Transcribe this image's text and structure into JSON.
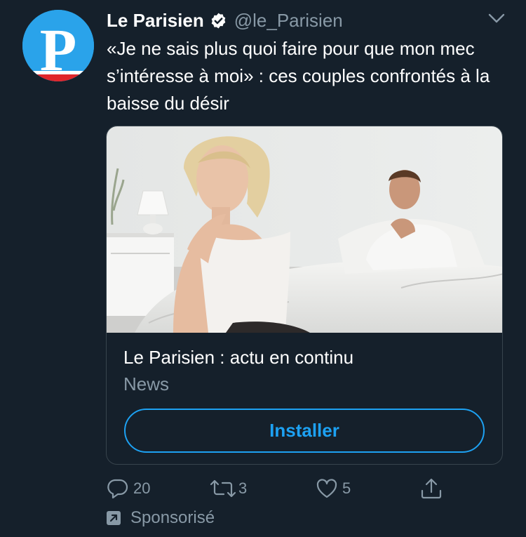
{
  "account": {
    "name": "Le Parisien",
    "handle": "@le_Parisien",
    "avatar_letter": "P"
  },
  "tweet": {
    "text": "«Je ne sais plus quoi faire pour que mon mec s’intéresse à moi» : ces couples confrontés à la baisse du désir"
  },
  "card": {
    "title": "Le Parisien : actu en continu",
    "category": "News",
    "button_label": "Installer"
  },
  "actions": {
    "replies": "20",
    "retweets": "3",
    "likes": "5"
  },
  "promoted": {
    "label": "Sponsorisé"
  },
  "colors": {
    "background": "#15202b",
    "accent": "#1da1f2",
    "muted": "#8899a6",
    "border": "#38444d"
  },
  "icons": [
    "verified-badge-icon",
    "chevron-down-icon",
    "reply-icon",
    "retweet-icon",
    "like-icon",
    "share-icon",
    "promoted-icon"
  ]
}
